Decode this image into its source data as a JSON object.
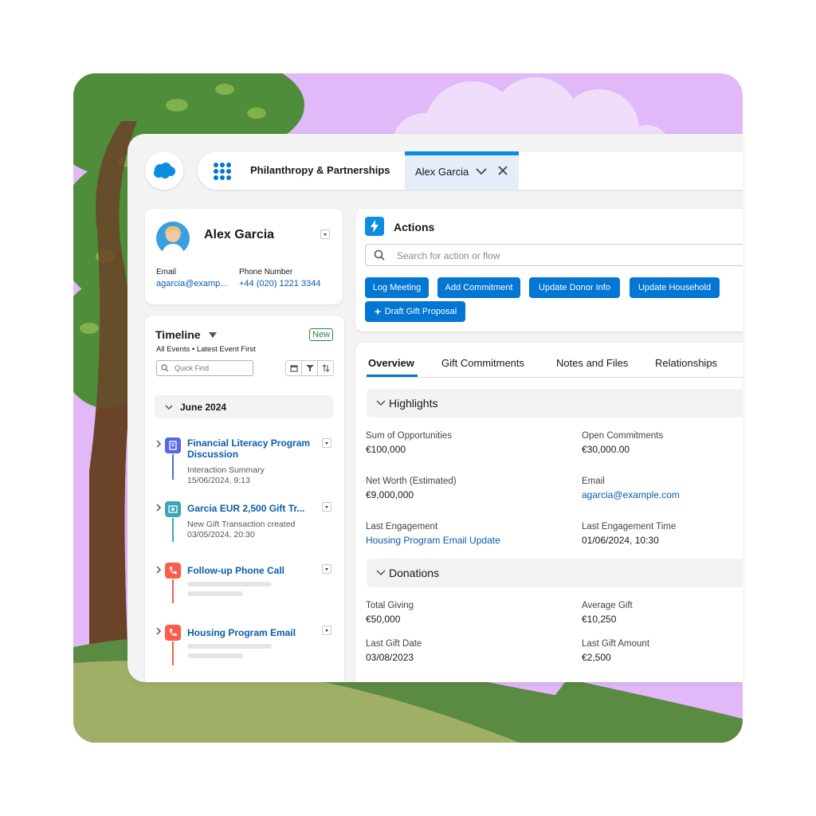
{
  "header": {
    "app_name": "Philanthropy & Partnerships",
    "active_tab": "Alex Garcia"
  },
  "profile": {
    "name": "Alex Garcia",
    "email_label": "Email",
    "email_value": "agarcia@examp...",
    "phone_label": "Phone Number",
    "phone_value": "+44 (020) 1221 3344"
  },
  "timeline": {
    "title": "Timeline",
    "new_label": "New",
    "subtitle": "All Events • Latest Event First",
    "search_placeholder": "Quick Find",
    "month": "June 2024",
    "items": [
      {
        "title_line1": "Financial Literacy Program",
        "title_line2": "Discussion",
        "sub1": "Interaction Summary",
        "sub2": "15/06/2024, 9:13",
        "icon": "note-icon",
        "color": "#5867e8"
      },
      {
        "title_line1": "Garcia EUR 2,500 Gift Tr...",
        "sub1": "New Gift Transaction created",
        "sub2": "03/05/2024, 20:30",
        "icon": "money-icon",
        "color": "#3ba6b4"
      },
      {
        "title_line1": "Follow-up Phone Call",
        "icon": "phone-icon",
        "color": "#fe5c4c"
      },
      {
        "title_line1": "Housing Program Email",
        "icon": "phone-icon",
        "color": "#fe5c4c"
      }
    ]
  },
  "actions": {
    "title": "Actions",
    "search_placeholder": "Search for action or flow",
    "buttons": [
      "Log Meeting",
      "Add Commitment",
      "Update Donor Info",
      "Update Household"
    ],
    "draft_button": "Draft Gift Proposal"
  },
  "tabs": [
    "Overview",
    "Gift Commitments",
    "Notes and Files",
    "Relationships"
  ],
  "highlights": {
    "title": "Highlights",
    "fields": [
      {
        "label": "Sum of Opportunities",
        "value": "€100,000"
      },
      {
        "label": "Open Commitments",
        "value": "€30,000.00"
      },
      {
        "label": "Net Worth (Estimated)",
        "value": "€9,000,000"
      },
      {
        "label": "Email",
        "value": "agarcia@example.com"
      },
      {
        "label": "Last Engagement",
        "value": "Housing Program Email Update"
      },
      {
        "label": "Last Engagement Time",
        "value": "01/06/2024, 10:30"
      }
    ]
  },
  "donations": {
    "title": "Donations",
    "fields": [
      {
        "label": "Total Giving",
        "value": "€50,000"
      },
      {
        "label": "Average Gift",
        "value": "€10,250"
      },
      {
        "label": "Last Gift Date",
        "value": "03/08/2023"
      },
      {
        "label": "Last Gift Amount",
        "value": "€2,500"
      }
    ]
  },
  "colors": {
    "brand": "#0176d3",
    "link": "#0b5cab",
    "background": "#e1b8f8"
  }
}
